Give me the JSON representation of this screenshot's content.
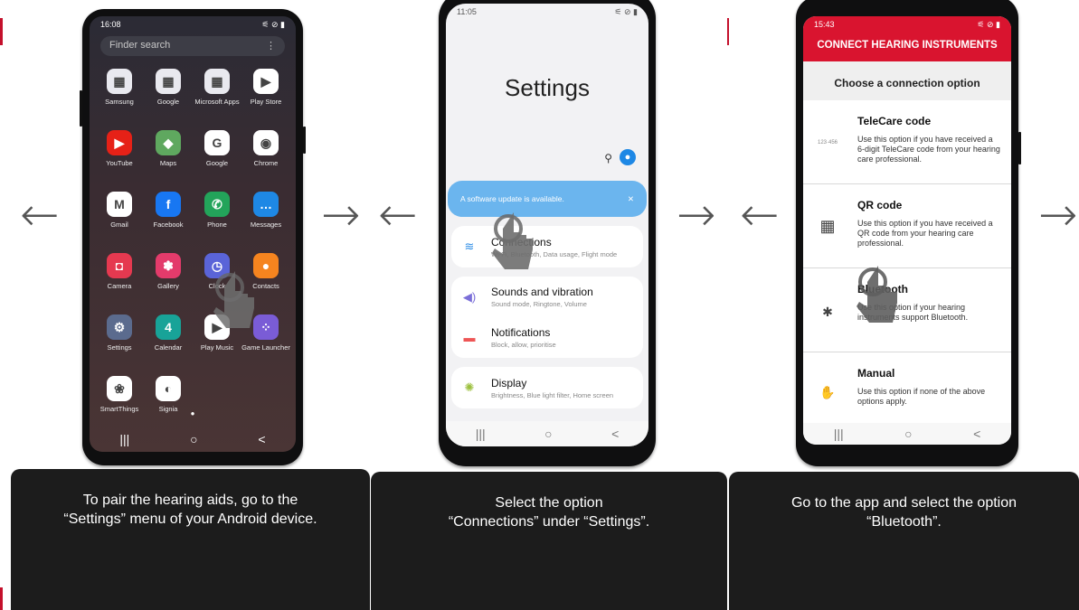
{
  "panel1": {
    "caption_line1": "To pair the hearing aids, go to the",
    "caption_line2": "“Settings” menu of your Android device.",
    "status_time": "16:08",
    "search_placeholder": "Finder search",
    "search_menu": "⋮",
    "apps": [
      {
        "label": "Samsung",
        "icon": "folder-icon",
        "color": "#e9e9ef",
        "glyph": "▦"
      },
      {
        "label": "Google",
        "icon": "folder-icon",
        "color": "#e9e9ef",
        "glyph": "▦"
      },
      {
        "label": "Microsoft Apps",
        "icon": "folder-icon",
        "color": "#e9e9ef",
        "glyph": "▦"
      },
      {
        "label": "Play Store",
        "icon": "play-store-icon",
        "color": "#ffffff",
        "glyph": "▶"
      },
      {
        "label": "YouTube",
        "icon": "youtube-icon",
        "color": "#e62117",
        "glyph": "▶"
      },
      {
        "label": "Maps",
        "icon": "maps-icon",
        "color": "#5fa85f",
        "glyph": "◆"
      },
      {
        "label": "Google",
        "icon": "google-icon",
        "color": "#ffffff",
        "glyph": "G"
      },
      {
        "label": "Chrome",
        "icon": "chrome-icon",
        "color": "#ffffff",
        "glyph": "◉"
      },
      {
        "label": "Gmail",
        "icon": "gmail-icon",
        "color": "#ffffff",
        "glyph": "M"
      },
      {
        "label": "Facebook",
        "icon": "facebook-icon",
        "color": "#1877f2",
        "glyph": "f"
      },
      {
        "label": "Phone",
        "icon": "phone-icon",
        "color": "#23a45a",
        "glyph": "✆"
      },
      {
        "label": "Messages",
        "icon": "messages-icon",
        "color": "#1e88e5",
        "glyph": "…"
      },
      {
        "label": "Camera",
        "icon": "camera-icon",
        "color": "#e53950",
        "glyph": "◘"
      },
      {
        "label": "Gallery",
        "icon": "gallery-icon",
        "color": "#e33b6b",
        "glyph": "✽"
      },
      {
        "label": "Clock",
        "icon": "clock-icon",
        "color": "#5a64d8",
        "glyph": "◷"
      },
      {
        "label": "Contacts",
        "icon": "contacts-icon",
        "color": "#f5841f",
        "glyph": "●"
      },
      {
        "label": "Settings",
        "icon": "settings-icon",
        "color": "#5b6b8e",
        "glyph": "⚙"
      },
      {
        "label": "Calendar",
        "icon": "calendar-icon",
        "color": "#18a398",
        "glyph": "4"
      },
      {
        "label": "Play Music",
        "icon": "play-music-icon",
        "color": "#ffffff",
        "glyph": "▶"
      },
      {
        "label": "Game Launcher",
        "icon": "game-launcher-icon",
        "color": "#7a5cd6",
        "glyph": "⁘"
      },
      {
        "label": "SmartThings",
        "icon": "smartthings-icon",
        "color": "#ffffff",
        "glyph": "❀"
      },
      {
        "label": "Signia",
        "icon": "signia-icon",
        "color": "#ffffff",
        "glyph": "◐"
      }
    ]
  },
  "panel2": {
    "caption_line1": "Select the option",
    "caption_line2": "“Connections” under “Settings”.",
    "status_time": "11:05",
    "title": "Settings",
    "update_banner": "A software update is available.",
    "items": [
      {
        "title": "Connections",
        "sub": "Wi-Fi, Bluetooth, Data usage, Flight mode",
        "icon": "wifi-icon",
        "glyph": "≋",
        "color": "#2f8ee6"
      },
      {
        "title": "Sounds and vibration",
        "sub": "Sound mode, Ringtone, Volume",
        "icon": "volume-icon",
        "glyph": "◀)",
        "color": "#7b6fd8"
      },
      {
        "title": "Notifications",
        "sub": "Block, allow, prioritise",
        "icon": "notifications-icon",
        "glyph": "▬",
        "color": "#ee5555"
      },
      {
        "title": "Display",
        "sub": "Brightness, Blue light filter, Home screen",
        "icon": "display-icon",
        "glyph": "✺",
        "color": "#9cc03e"
      }
    ]
  },
  "panel3": {
    "caption_line1": "Go to the app and select the option",
    "caption_line2": "“Bluetooth”.",
    "status_time": "15:43",
    "appbar_title": "CONNECT HEARING INSTRUMENTS",
    "subheader": "Choose a connection option",
    "options": [
      {
        "title": "TeleCare code",
        "text": "Use this option if you have received a 6-digit TeleCare code from your hearing care professional.",
        "icon": "telecare-code-icon",
        "glyph": "123·456"
      },
      {
        "title": "QR code",
        "text": "Use this option if you have received a QR code from your hearing care professional.",
        "icon": "qr-code-icon",
        "glyph": "▦"
      },
      {
        "title": "Bluetooth",
        "text": "Use this option if your hearing instruments support Bluetooth.",
        "icon": "bluetooth-icon",
        "glyph": "✱"
      },
      {
        "title": "Manual",
        "text": "Use this option if none of the above options apply.",
        "icon": "hand-icon",
        "glyph": "✋"
      }
    ]
  },
  "arrows": {
    "left": "←",
    "right": "→"
  },
  "nav": {
    "recent": "|||",
    "home": "○",
    "back": "<"
  }
}
